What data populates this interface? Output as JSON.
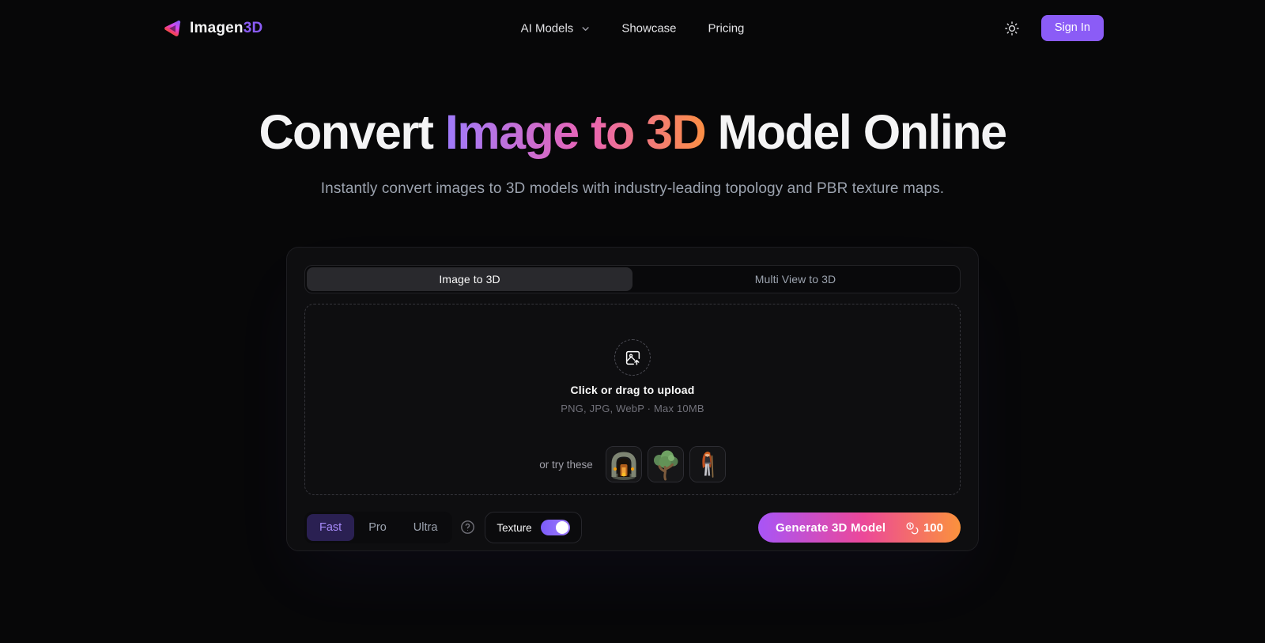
{
  "brand": {
    "name_primary": "Imagen",
    "name_accent": "3D"
  },
  "nav": {
    "items": [
      {
        "label": "AI Models",
        "has_dropdown": true
      },
      {
        "label": "Showcase",
        "has_dropdown": false
      },
      {
        "label": "Pricing",
        "has_dropdown": false
      }
    ],
    "theme_icon": "sun-icon",
    "sign_in_label": "Sign In"
  },
  "hero": {
    "title_prefix": "Convert ",
    "title_gradient": "Image to 3D",
    "title_suffix": " Model Online",
    "subtitle": "Instantly convert images to 3D models with industry-leading topology and PBR texture maps."
  },
  "converter": {
    "tabs": [
      {
        "label": "Image to 3D",
        "active": true
      },
      {
        "label": "Multi View to 3D",
        "active": false
      }
    ],
    "upload": {
      "icon": "image-upload-icon",
      "title": "Click or drag to upload",
      "hint": "PNG, JPG, WebP · Max 10MB",
      "try_label": "or try these",
      "samples": [
        {
          "name": "dungeon-arch"
        },
        {
          "name": "tree"
        },
        {
          "name": "warrior-character"
        }
      ]
    },
    "quality_options": [
      {
        "label": "Fast",
        "active": true
      },
      {
        "label": "Pro",
        "active": false
      },
      {
        "label": "Ultra",
        "active": false
      }
    ],
    "help_icon": "question-circle-icon",
    "texture_toggle": {
      "label": "Texture",
      "enabled": true
    },
    "generate": {
      "label": "Generate 3D Model",
      "coin_icon": "coins-icon",
      "credits": "100"
    }
  },
  "colors": {
    "page_bg": "#070708",
    "card_bg": "#0e0e10",
    "accent_purple": "#8b5cf6",
    "title_gradient": [
      "#9f7bfb",
      "#e964b4",
      "#fb8e44"
    ],
    "generate_gradient": [
      "#a855f7",
      "#ec4899",
      "#fb923c"
    ],
    "quality_active_bg": "#2a2052",
    "quality_active_text": "#a78bfa"
  }
}
